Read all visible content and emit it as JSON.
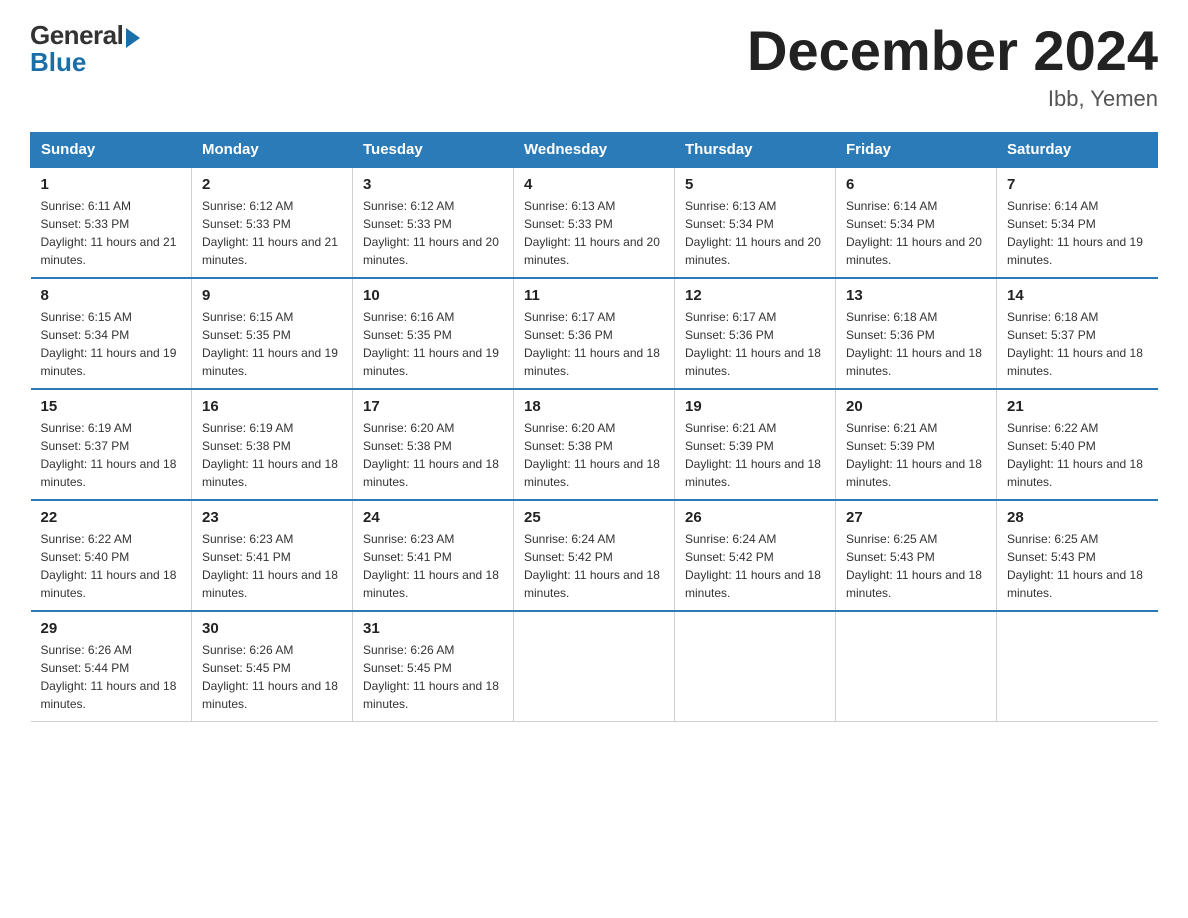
{
  "logo": {
    "general": "General",
    "blue": "Blue"
  },
  "title": "December 2024",
  "subtitle": "Ibb, Yemen",
  "days_of_week": [
    "Sunday",
    "Monday",
    "Tuesday",
    "Wednesday",
    "Thursday",
    "Friday",
    "Saturday"
  ],
  "weeks": [
    [
      {
        "day": "1",
        "sunrise": "6:11 AM",
        "sunset": "5:33 PM",
        "daylight": "11 hours and 21 minutes."
      },
      {
        "day": "2",
        "sunrise": "6:12 AM",
        "sunset": "5:33 PM",
        "daylight": "11 hours and 21 minutes."
      },
      {
        "day": "3",
        "sunrise": "6:12 AM",
        "sunset": "5:33 PM",
        "daylight": "11 hours and 20 minutes."
      },
      {
        "day": "4",
        "sunrise": "6:13 AM",
        "sunset": "5:33 PM",
        "daylight": "11 hours and 20 minutes."
      },
      {
        "day": "5",
        "sunrise": "6:13 AM",
        "sunset": "5:34 PM",
        "daylight": "11 hours and 20 minutes."
      },
      {
        "day": "6",
        "sunrise": "6:14 AM",
        "sunset": "5:34 PM",
        "daylight": "11 hours and 20 minutes."
      },
      {
        "day": "7",
        "sunrise": "6:14 AM",
        "sunset": "5:34 PM",
        "daylight": "11 hours and 19 minutes."
      }
    ],
    [
      {
        "day": "8",
        "sunrise": "6:15 AM",
        "sunset": "5:34 PM",
        "daylight": "11 hours and 19 minutes."
      },
      {
        "day": "9",
        "sunrise": "6:15 AM",
        "sunset": "5:35 PM",
        "daylight": "11 hours and 19 minutes."
      },
      {
        "day": "10",
        "sunrise": "6:16 AM",
        "sunset": "5:35 PM",
        "daylight": "11 hours and 19 minutes."
      },
      {
        "day": "11",
        "sunrise": "6:17 AM",
        "sunset": "5:36 PM",
        "daylight": "11 hours and 18 minutes."
      },
      {
        "day": "12",
        "sunrise": "6:17 AM",
        "sunset": "5:36 PM",
        "daylight": "11 hours and 18 minutes."
      },
      {
        "day": "13",
        "sunrise": "6:18 AM",
        "sunset": "5:36 PM",
        "daylight": "11 hours and 18 minutes."
      },
      {
        "day": "14",
        "sunrise": "6:18 AM",
        "sunset": "5:37 PM",
        "daylight": "11 hours and 18 minutes."
      }
    ],
    [
      {
        "day": "15",
        "sunrise": "6:19 AM",
        "sunset": "5:37 PM",
        "daylight": "11 hours and 18 minutes."
      },
      {
        "day": "16",
        "sunrise": "6:19 AM",
        "sunset": "5:38 PM",
        "daylight": "11 hours and 18 minutes."
      },
      {
        "day": "17",
        "sunrise": "6:20 AM",
        "sunset": "5:38 PM",
        "daylight": "11 hours and 18 minutes."
      },
      {
        "day": "18",
        "sunrise": "6:20 AM",
        "sunset": "5:38 PM",
        "daylight": "11 hours and 18 minutes."
      },
      {
        "day": "19",
        "sunrise": "6:21 AM",
        "sunset": "5:39 PM",
        "daylight": "11 hours and 18 minutes."
      },
      {
        "day": "20",
        "sunrise": "6:21 AM",
        "sunset": "5:39 PM",
        "daylight": "11 hours and 18 minutes."
      },
      {
        "day": "21",
        "sunrise": "6:22 AM",
        "sunset": "5:40 PM",
        "daylight": "11 hours and 18 minutes."
      }
    ],
    [
      {
        "day": "22",
        "sunrise": "6:22 AM",
        "sunset": "5:40 PM",
        "daylight": "11 hours and 18 minutes."
      },
      {
        "day": "23",
        "sunrise": "6:23 AM",
        "sunset": "5:41 PM",
        "daylight": "11 hours and 18 minutes."
      },
      {
        "day": "24",
        "sunrise": "6:23 AM",
        "sunset": "5:41 PM",
        "daylight": "11 hours and 18 minutes."
      },
      {
        "day": "25",
        "sunrise": "6:24 AM",
        "sunset": "5:42 PM",
        "daylight": "11 hours and 18 minutes."
      },
      {
        "day": "26",
        "sunrise": "6:24 AM",
        "sunset": "5:42 PM",
        "daylight": "11 hours and 18 minutes."
      },
      {
        "day": "27",
        "sunrise": "6:25 AM",
        "sunset": "5:43 PM",
        "daylight": "11 hours and 18 minutes."
      },
      {
        "day": "28",
        "sunrise": "6:25 AM",
        "sunset": "5:43 PM",
        "daylight": "11 hours and 18 minutes."
      }
    ],
    [
      {
        "day": "29",
        "sunrise": "6:26 AM",
        "sunset": "5:44 PM",
        "daylight": "11 hours and 18 minutes."
      },
      {
        "day": "30",
        "sunrise": "6:26 AM",
        "sunset": "5:45 PM",
        "daylight": "11 hours and 18 minutes."
      },
      {
        "day": "31",
        "sunrise": "6:26 AM",
        "sunset": "5:45 PM",
        "daylight": "11 hours and 18 minutes."
      },
      null,
      null,
      null,
      null
    ]
  ]
}
